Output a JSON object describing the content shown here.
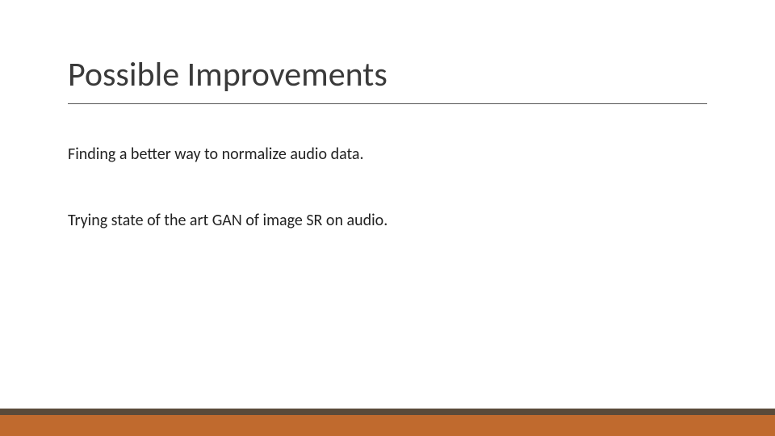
{
  "slide": {
    "title": "Possible Improvements",
    "body": [
      "Finding a better way to normalize audio data.",
      "Trying state of the art GAN of image SR on audio."
    ]
  },
  "theme": {
    "accent_bar_top": "#5a4a3a",
    "accent_bar_bottom": "#c06a2e",
    "title_rule": "#555555"
  }
}
